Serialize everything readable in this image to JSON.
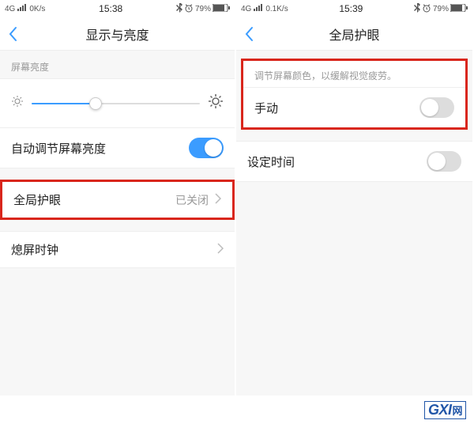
{
  "left": {
    "status": {
      "net": "4G",
      "speed": "0K/s",
      "time": "15:38",
      "battery": "79%"
    },
    "title": "显示与亮度",
    "brightness_label": "屏幕亮度",
    "auto_brightness": "自动调节屏幕亮度",
    "eye_care": "全局护眼",
    "eye_care_status": "已关闭",
    "screen_clock": "熄屏时钟"
  },
  "right": {
    "status": {
      "net": "4G",
      "speed": "0.1K/s",
      "time": "15:39",
      "battery": "79%"
    },
    "title": "全局护眼",
    "hint": "调节屏幕颜色，以缓解视觉疲劳。",
    "manual": "手动",
    "schedule": "设定时间"
  },
  "watermark": {
    "text": "GXI",
    "suffix": "网"
  }
}
